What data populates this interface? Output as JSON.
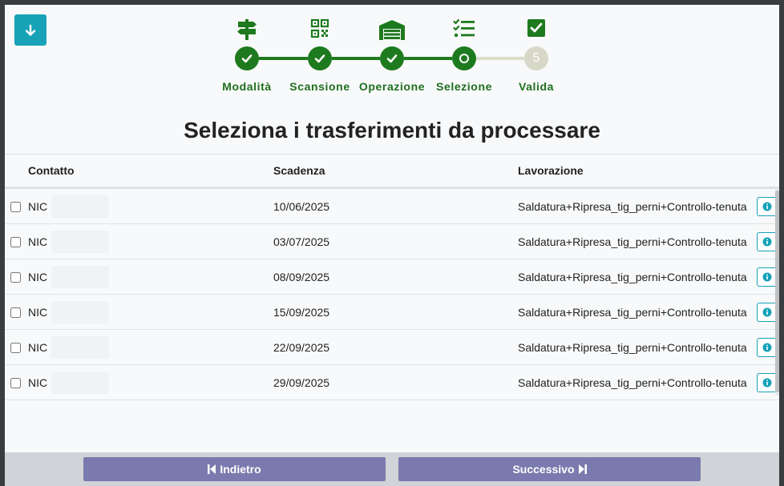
{
  "download_button": {
    "icon": "arrow-down-icon",
    "color": "#17a2b8"
  },
  "steps": [
    {
      "label": "Modalità",
      "icon": "signpost-icon",
      "status": "done"
    },
    {
      "label": "Scansione",
      "icon": "qr-code-icon",
      "status": "done"
    },
    {
      "label": "Operazione",
      "icon": "warehouse-icon",
      "status": "done"
    },
    {
      "label": "Selezione",
      "icon": "task-list-icon",
      "status": "current"
    },
    {
      "label": "Valida",
      "icon": "checkbox-icon",
      "status": "todo",
      "number": "5"
    }
  ],
  "title": "Seleziona i trasferimenti da processare",
  "table": {
    "headers": {
      "contatto": "Contatto",
      "scadenza": "Scadenza",
      "lavorazione": "Lavorazione"
    },
    "rows": [
      {
        "contatto": "NIC",
        "scadenza": "10/06/2025",
        "lavorazione": "Saldatura+Ripresa_tig_perni+Controllo-tenuta"
      },
      {
        "contatto": "NIC",
        "scadenza": "03/07/2025",
        "lavorazione": "Saldatura+Ripresa_tig_perni+Controllo-tenuta"
      },
      {
        "contatto": "NIC",
        "scadenza": "08/09/2025",
        "lavorazione": "Saldatura+Ripresa_tig_perni+Controllo-tenuta"
      },
      {
        "contatto": "NIC",
        "scadenza": "15/09/2025",
        "lavorazione": "Saldatura+Ripresa_tig_perni+Controllo-tenuta"
      },
      {
        "contatto": "NIC",
        "scadenza": "22/09/2025",
        "lavorazione": "Saldatura+Ripresa_tig_perni+Controllo-tenuta"
      },
      {
        "contatto": "NIC",
        "scadenza": "29/09/2025",
        "lavorazione": "Saldatura+Ripresa_tig_perni+Controllo-tenuta"
      }
    ]
  },
  "footer": {
    "back_label": "Indietro",
    "next_label": "Successivo"
  },
  "colors": {
    "step_green": "#1e7a1e",
    "accent": "#17a2b8",
    "button": "#7b7aae"
  }
}
